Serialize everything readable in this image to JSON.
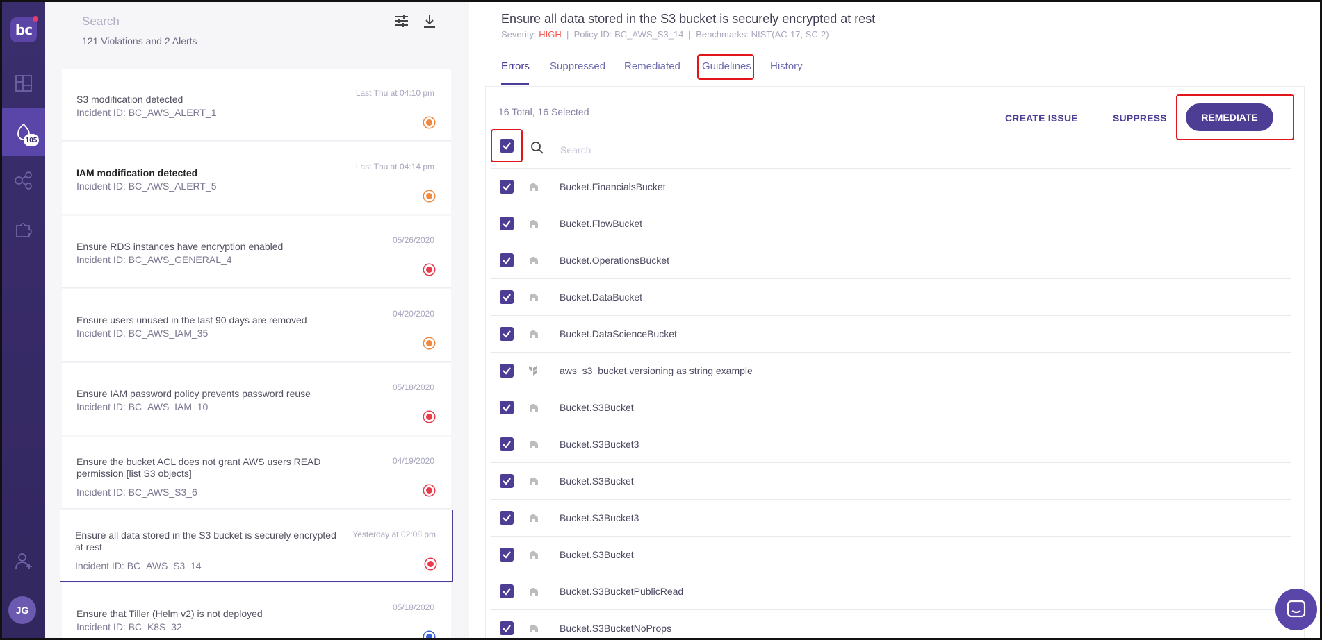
{
  "sidebar": {
    "logo_text": "bc",
    "badge_count": "105",
    "user_initials": "JG",
    "icons": [
      "logo-icon",
      "dashboard-icon",
      "incidents-icon",
      "connections-icon",
      "integrations-icon",
      "add-user-icon"
    ]
  },
  "list": {
    "search_placeholder": "Search",
    "summary": "121 Violations and 2 Alerts",
    "items": [
      {
        "title": "S3 modification detected",
        "incident": "Incident ID: BC_AWS_ALERT_1",
        "date": "Last Thu at 04:10 pm",
        "status_color": "#f0883f",
        "bold": false
      },
      {
        "title": "IAM modification detected",
        "incident": "Incident ID: BC_AWS_ALERT_5",
        "date": "Last Thu at 04:14 pm",
        "status_color": "#f0883f",
        "bold": true
      },
      {
        "title": "Ensure RDS instances have encryption enabled",
        "incident": "Incident ID: BC_AWS_GENERAL_4",
        "date": "05/26/2020",
        "status_color": "#ea3b4d",
        "bold": false
      },
      {
        "title": "Ensure users unused in the last 90 days are removed",
        "incident": "Incident ID: BC_AWS_IAM_35",
        "date": "04/20/2020",
        "status_color": "#f0883f",
        "bold": false
      },
      {
        "title": "Ensure IAM password policy prevents password reuse",
        "incident": "Incident ID: BC_AWS_IAM_10",
        "date": "05/18/2020",
        "status_color": "#ea3b4d",
        "bold": false
      },
      {
        "title": "Ensure the bucket ACL does not grant AWS users READ permission [list S3 objects]",
        "incident": "Incident ID: BC_AWS_S3_6",
        "date": "04/19/2020",
        "status_color": "#ea3b4d",
        "bold": false
      },
      {
        "title": "Ensure all data stored in the S3 bucket is securely encrypted at rest",
        "incident": "Incident ID: BC_AWS_S3_14",
        "date": "Yesterday at 02:08 pm",
        "status_color": "#ea3b4d",
        "bold": false
      },
      {
        "title": "Ensure that Tiller (Helm v2) is not deployed",
        "incident": "Incident ID: BC_K8S_32",
        "date": "05/18/2020",
        "status_color": "#3b5fd6",
        "bold": false
      }
    ]
  },
  "detail": {
    "title": "Ensure all data stored in the S3 bucket is securely encrypted at rest",
    "severity_label": "Severity:",
    "severity_value": "HIGH",
    "policy": "Policy ID: BC_AWS_S3_14",
    "benchmarks": "Benchmarks: NIST(AC-17, SC-2)",
    "sep": "|",
    "tabs": [
      "Errors",
      "Suppressed",
      "Remediated",
      "Guidelines",
      "History"
    ],
    "active_tab": "Errors",
    "total_text": "16 Total, 16 Selected",
    "create_issue": "CREATE ISSUE",
    "suppress": "SUPPRESS",
    "remediate": "REMEDIATE",
    "table_search_placeholder": "Search",
    "rows": [
      {
        "label": "Bucket.FinancialsBucket",
        "icon": "cloudformation-icon"
      },
      {
        "label": "Bucket.FlowBucket",
        "icon": "cloudformation-icon"
      },
      {
        "label": "Bucket.OperationsBucket",
        "icon": "cloudformation-icon"
      },
      {
        "label": "Bucket.DataBucket",
        "icon": "cloudformation-icon"
      },
      {
        "label": "Bucket.DataScienceBucket",
        "icon": "cloudformation-icon"
      },
      {
        "label": "aws_s3_bucket.versioning as string example",
        "icon": "terraform-icon"
      },
      {
        "label": "Bucket.S3Bucket",
        "icon": "cloudformation-icon"
      },
      {
        "label": "Bucket.S3Bucket3",
        "icon": "cloudformation-icon"
      },
      {
        "label": "Bucket.S3Bucket",
        "icon": "cloudformation-icon"
      },
      {
        "label": "Bucket.S3Bucket3",
        "icon": "cloudformation-icon"
      },
      {
        "label": "Bucket.S3Bucket",
        "icon": "cloudformation-icon"
      },
      {
        "label": "Bucket.S3BucketPublicRead",
        "icon": "cloudformation-icon"
      },
      {
        "label": "Bucket.S3BucketNoProps",
        "icon": "cloudformation-icon"
      }
    ]
  },
  "colors": {
    "accent": "#4d3d94",
    "sidebar": "#3a2d6b",
    "severity_high": "#f0574f",
    "highlight_box": "#e0161b"
  }
}
